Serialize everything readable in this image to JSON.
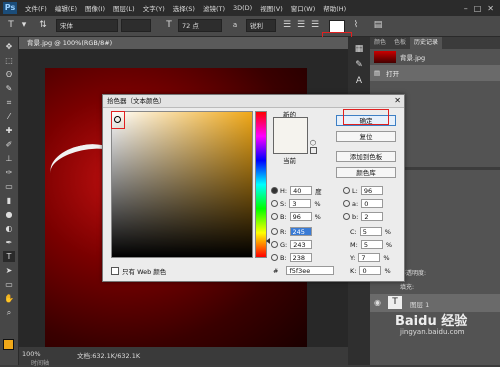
{
  "app": {
    "logo": "Ps"
  },
  "menu": [
    "文件(F)",
    "编辑(E)",
    "图像(I)",
    "图层(L)",
    "文字(Y)",
    "选择(S)",
    "滤镜(T)",
    "3D(D)",
    "视图(V)",
    "窗口(W)",
    "帮助(H)"
  ],
  "window_controls": [
    "–",
    "□",
    "✕"
  ],
  "options": {
    "font": "宋体",
    "size": "72 点",
    "aa": "锐利"
  },
  "document": {
    "tab": "背景.jpg @ 100%(RGB/8#)",
    "zoom": "100%",
    "doc_size": "文档:632.1K/632.1K",
    "timeline": "时间轴"
  },
  "history": {
    "tabs": [
      "颜色",
      "色板",
      "历史记录"
    ],
    "snapshot": "背景.jpg",
    "step": "打开"
  },
  "layers": {
    "opacity_label": "不透明度:",
    "fill_label": "填充:",
    "layer_name": "图层 1"
  },
  "dialog": {
    "title": "拾色器（文本颜色）",
    "close": "✕",
    "new_label": "新的",
    "current_label": "当前",
    "buttons": {
      "ok": "确定",
      "reset": "复位",
      "add_swatch": "添加到色板",
      "libraries": "颜色库"
    },
    "hsb": {
      "H": "40",
      "S": "3",
      "B": "96"
    },
    "hsb_units": {
      "H": "度",
      "S": "%",
      "B": "%"
    },
    "rgb": {
      "R": "245",
      "G": "243",
      "B": "238"
    },
    "lab": {
      "L": "96",
      "a": "0",
      "b": "2"
    },
    "cmyk": {
      "C": "5",
      "M": "5",
      "Y": "7",
      "K": "0"
    },
    "web_only": "只有 Web 颜色",
    "hex_label": "#",
    "hex": "f5f3ee"
  },
  "watermark": {
    "brand": "Baidu 经验",
    "url": "jingyan.baidu.com"
  },
  "colors": {
    "new": "#f5f3ee",
    "current": "#f5f3ee",
    "highlight": "#e02020"
  }
}
